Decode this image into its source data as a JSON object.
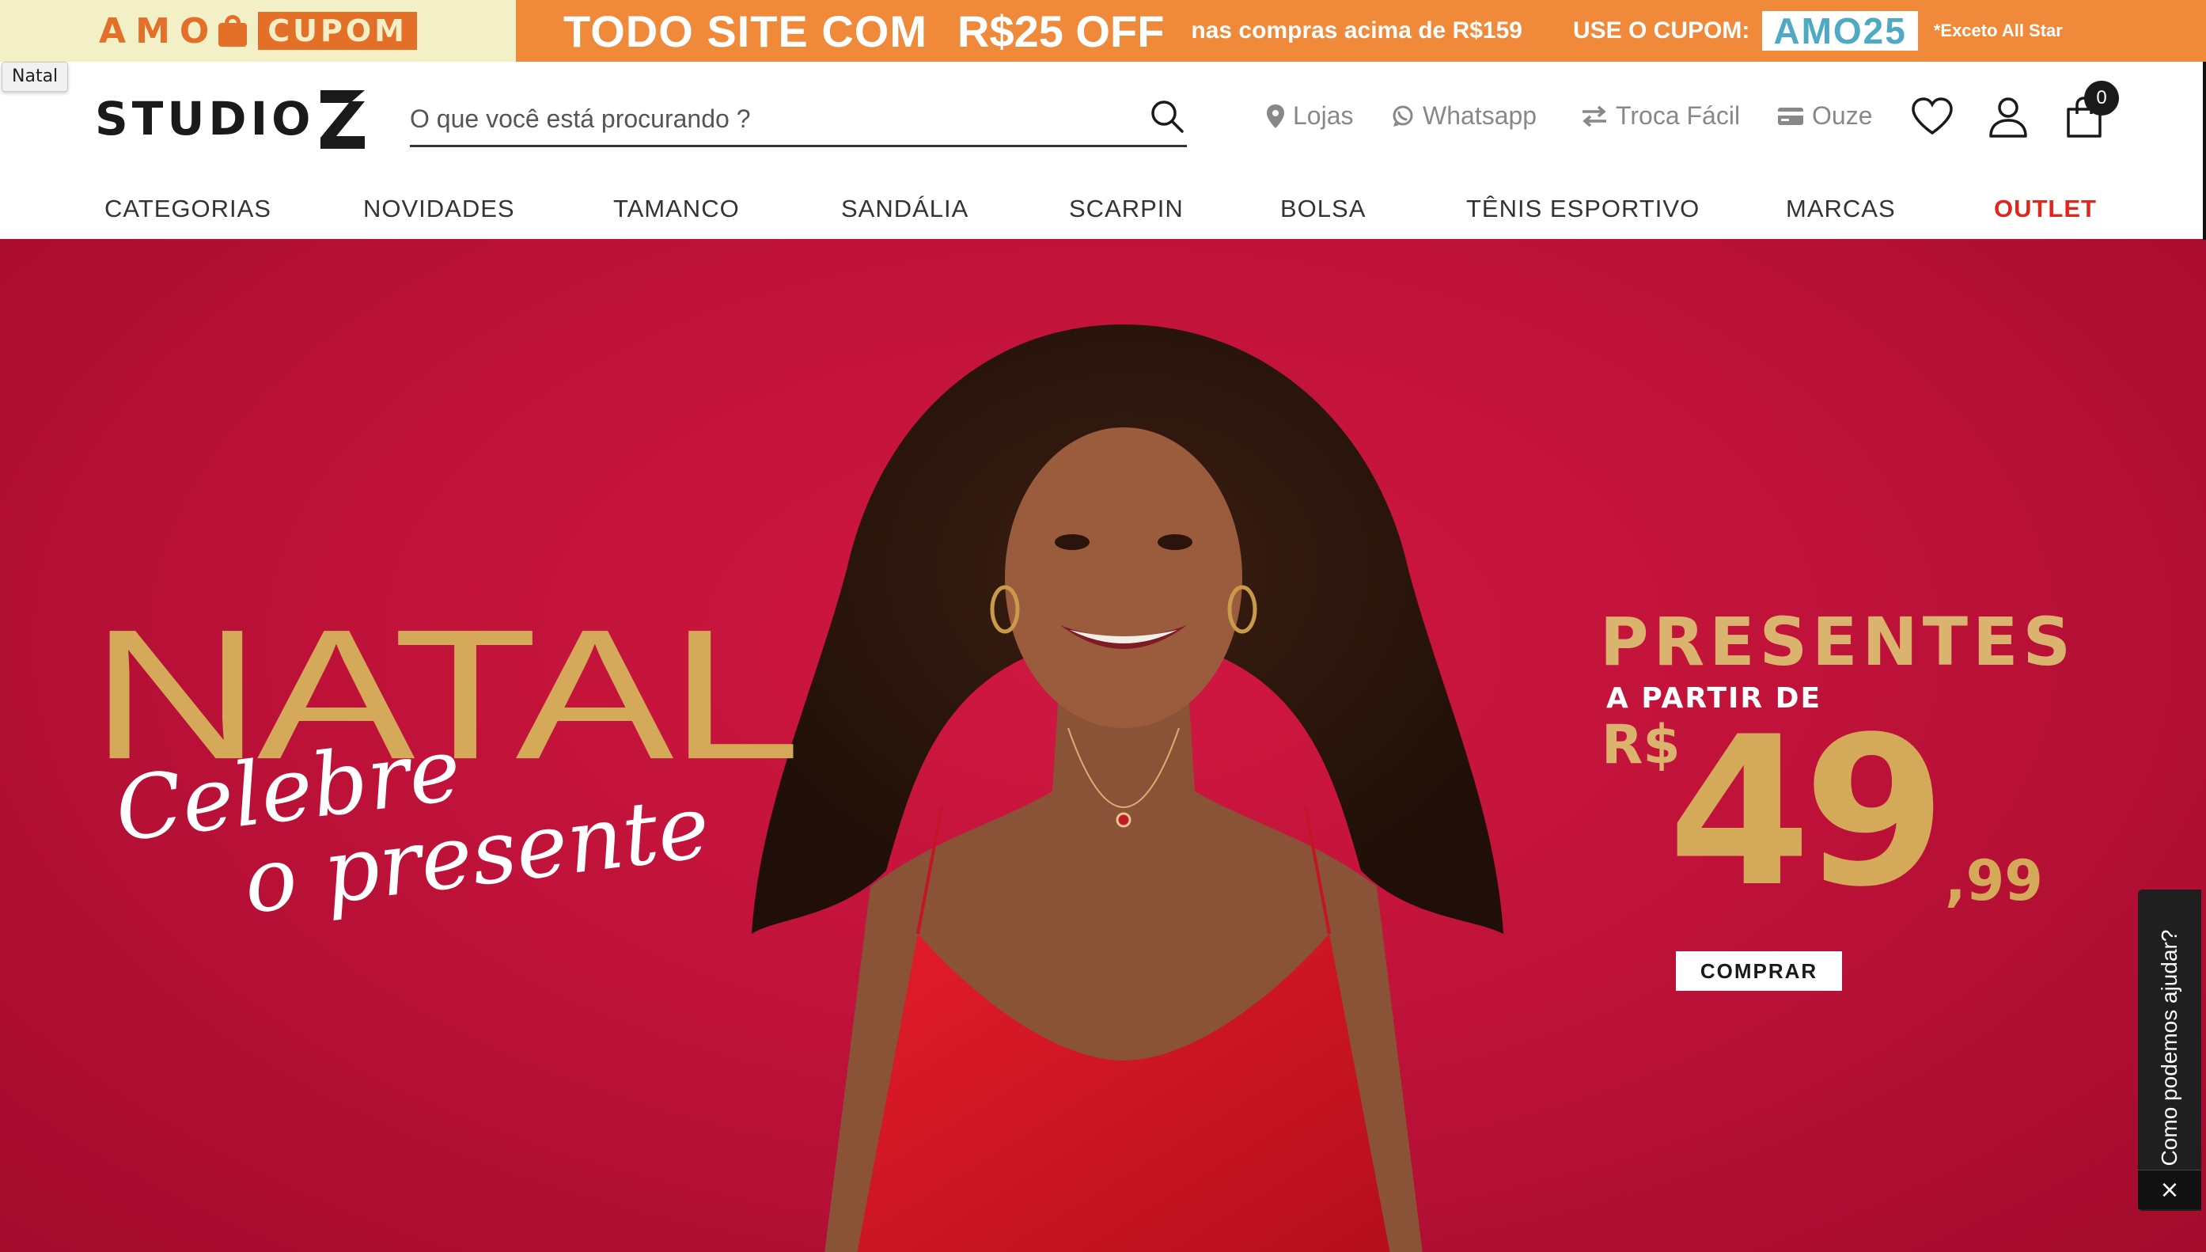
{
  "promo": {
    "amo": "AMO",
    "cupom": "CUPOM",
    "headline": "TODO SITE COM",
    "off": "R$25 OFF",
    "condition": "nas compras acima de R$159",
    "use_coupon": "USE O CUPOM:",
    "code": "AMO25",
    "exception": "*Exceto All Star"
  },
  "tooltip": "Natal",
  "header": {
    "logo": "STUDIO",
    "search_placeholder": "O que você está procurando ?",
    "links": {
      "lojas": "Lojas",
      "whatsapp": "Whatsapp",
      "troca": "Troca Fácil",
      "ouze": "Ouze"
    },
    "cart_count": "0"
  },
  "nav": {
    "items": [
      "CATEGORIAS",
      "NOVIDADES",
      "TAMANCO",
      "SANDÁLIA",
      "SCARPIN",
      "BOLSA",
      "TÊNIS ESPORTIVO",
      "MARCAS",
      "OUTLET"
    ]
  },
  "hero": {
    "title": "NATAL",
    "subtitle_line1": "Celebre",
    "subtitle_line2": "o presente",
    "presentes": "PRESENTES",
    "a_partir": "A PARTIR DE",
    "currency": "R$",
    "price": "49",
    "cents": ",99",
    "cta": "COMPRAR"
  },
  "help": {
    "label": "Como podemos ajudar?",
    "close": "×"
  },
  "colors": {
    "promo_orange": "#f08a3a",
    "promo_cream": "#f3f0c7",
    "hero_red": "#c0123a",
    "gold": "#d4a95a",
    "outlet_red": "#e1261c"
  }
}
